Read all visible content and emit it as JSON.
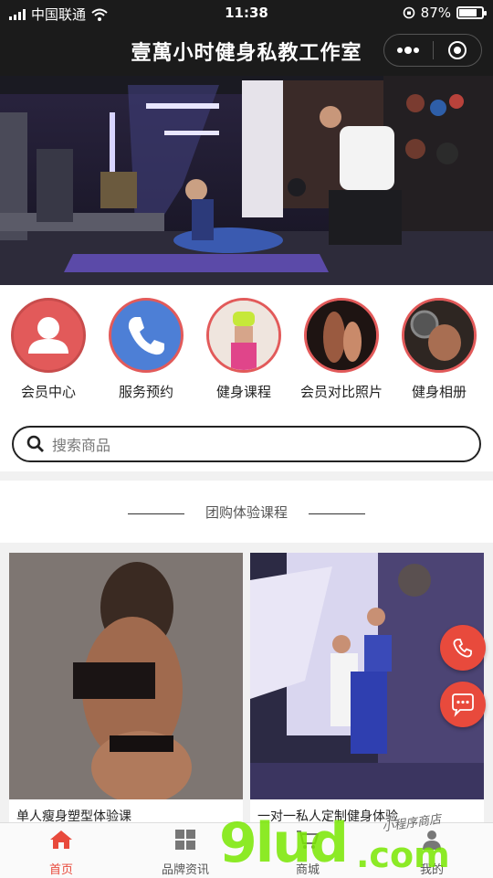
{
  "status_bar": {
    "carrier": "中国联通",
    "time": "11:38",
    "battery_percent": "87%",
    "battery_level": 0.87
  },
  "navbar": {
    "title": "壹萬小时健身私教工作室"
  },
  "icon_nav": [
    {
      "label": "会员中心",
      "icon": "person-icon"
    },
    {
      "label": "服务预约",
      "icon": "phone-icon"
    },
    {
      "label": "健身课程",
      "icon": "course-photo"
    },
    {
      "label": "会员对比照片",
      "icon": "compare-photo"
    },
    {
      "label": "健身相册",
      "icon": "album-photo"
    }
  ],
  "search": {
    "placeholder": "搜索商品"
  },
  "section": {
    "title": "团购体验课程"
  },
  "products": [
    {
      "name": "单人瘦身塑型体验课"
    },
    {
      "name": "一对一私人定制健身体验"
    }
  ],
  "tabbar": [
    {
      "label": "首页",
      "icon": "home-icon",
      "active": true
    },
    {
      "label": "品牌资讯",
      "icon": "grid-icon",
      "active": false
    },
    {
      "label": "商城",
      "icon": "cart-icon",
      "active": false
    },
    {
      "label": "我的",
      "icon": "user-icon",
      "active": false
    }
  ],
  "watermark": {
    "main": "9lud",
    "suffix": ".com",
    "script": "小程序商店"
  },
  "colors": {
    "accent": "#e84a3c",
    "dark_bar": "#1b1b1b",
    "member_circle": "#e25a5a",
    "service_circle": "#4d7fd6"
  }
}
